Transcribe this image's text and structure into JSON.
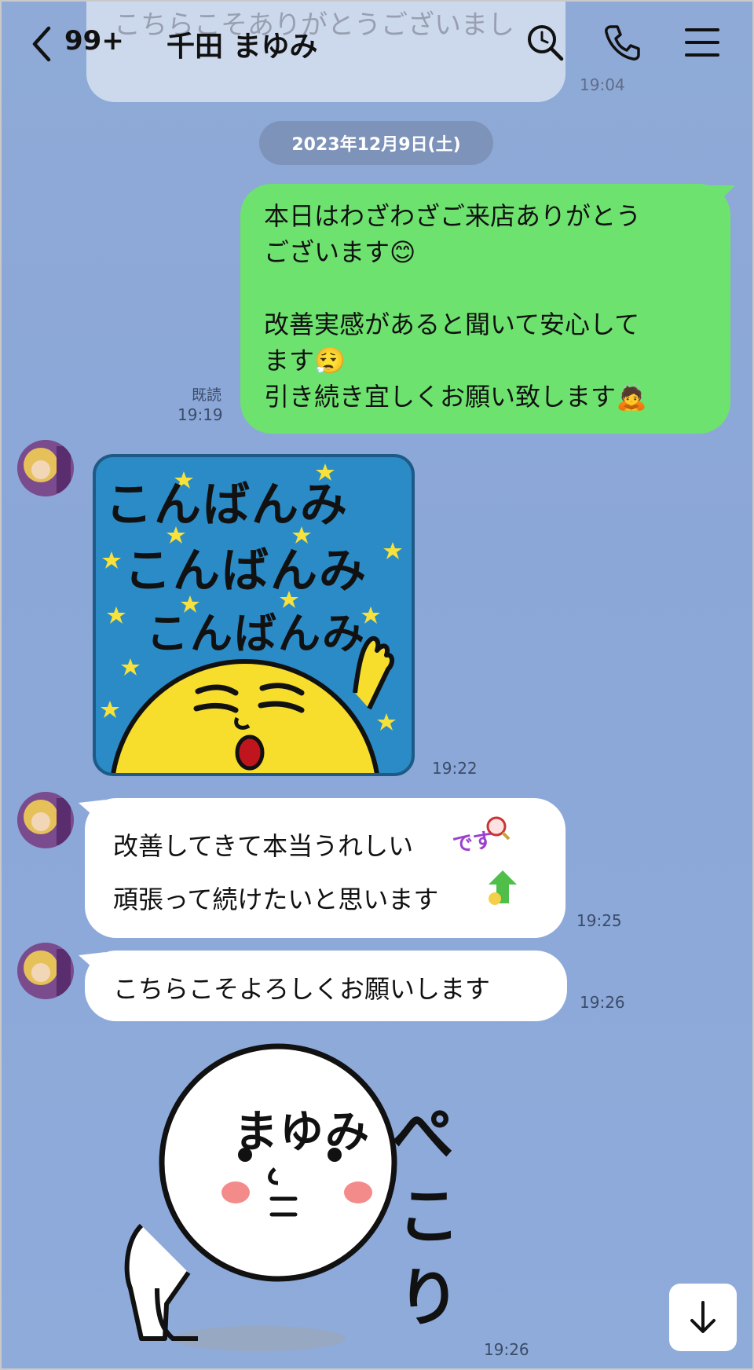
{
  "header": {
    "unread_count": "99+",
    "contact_name": "千田 まゆみ",
    "prev_message_text": "こちらこそありがとうございまし",
    "prev_message_time": "19:04"
  },
  "date_separator": "2023年12月9日(土)",
  "outgoing": {
    "lines": [
      "本日はわざわざご来店ありがとう",
      "ございます😊",
      "",
      "改善実感があると聞いて安心して",
      "ます😮‍💨",
      "引き続き宜しくお願い致します🙇"
    ],
    "read_label": "既読",
    "time": "19:19"
  },
  "sticker1": {
    "text_rows": [
      "こんばんみ",
      "こんばんみ",
      "こんばんみ"
    ],
    "time": "19:22"
  },
  "incoming1": {
    "lines": [
      "改善してきて本当うれしい",
      "頑張って続けたいと思います"
    ],
    "badge_text": "です",
    "time": "19:25"
  },
  "incoming2": {
    "text": "こちらこそよろしくお願いします",
    "time": "19:26"
  },
  "sticker2": {
    "name_text": "まゆみ",
    "bow_text": [
      "ぺ",
      "こ",
      "り"
    ],
    "time": "19:26"
  },
  "icons": {
    "back": "chevron-left-icon",
    "search": "search-icon",
    "call": "phone-icon",
    "menu": "menu-icon",
    "scroll": "arrow-down-icon"
  },
  "colors": {
    "background": "#8ba7d8",
    "outgoing_bubble": "#6ee26f",
    "incoming_bubble": "#ffffff",
    "date_pill": "#7e93b9"
  }
}
